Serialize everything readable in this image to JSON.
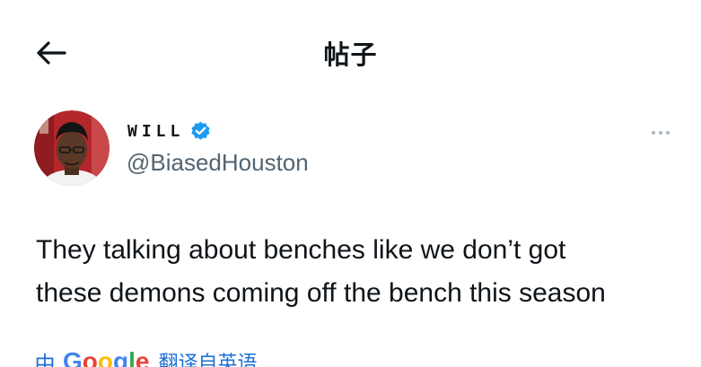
{
  "header": {
    "back_icon": "back-arrow-icon",
    "title": "帖子"
  },
  "author": {
    "display_name": "WILL",
    "verified_icon": "verified-badge-icon",
    "verified_color": "#1d9bf0",
    "handle": "@BiasedHouston",
    "more_icon": "more-options-icon"
  },
  "tweet": {
    "lines": [
      "They talking about benches like we don’t got",
      "these demons coming off the bench this season"
    ]
  },
  "translate": {
    "prefix": "由",
    "google_letters": [
      "G",
      "o",
      "o",
      "g",
      "l",
      "e"
    ],
    "google_colors": [
      "#4285f4",
      "#ea4335",
      "#fbbc05",
      "#4285f4",
      "#34a853",
      "#ea4335"
    ],
    "label": "翻译自英语"
  }
}
